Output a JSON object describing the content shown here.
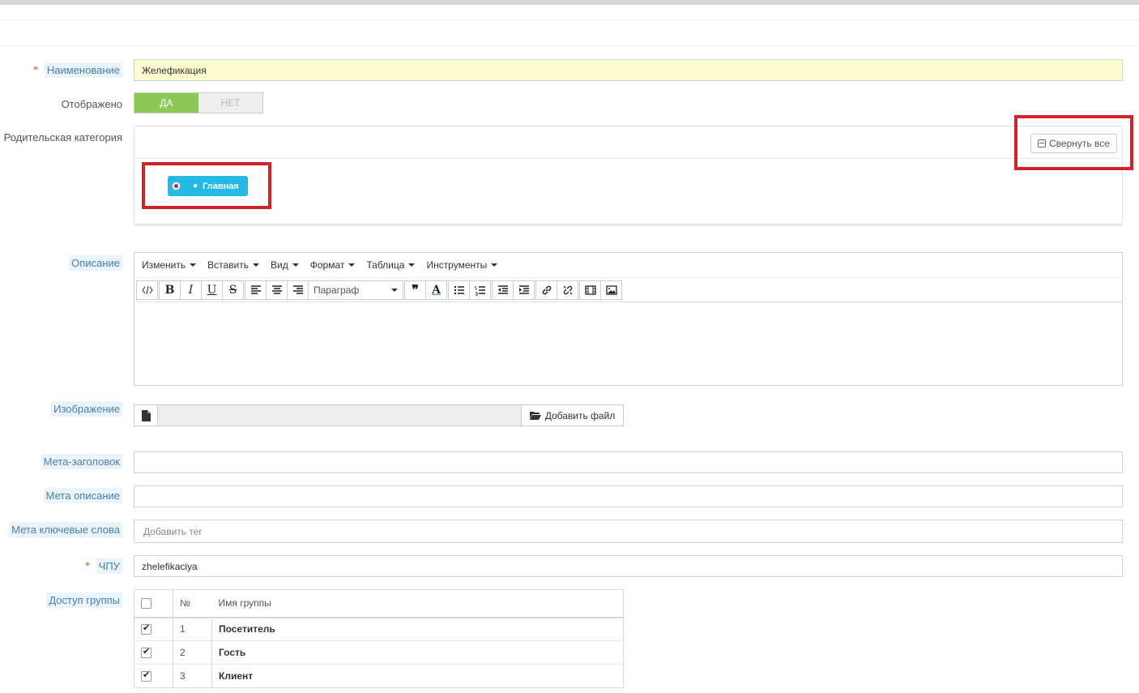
{
  "form": {
    "name": {
      "label": "Наименование",
      "value": "Желефикация",
      "required": true
    },
    "displayed": {
      "label": "Отображено",
      "yes": "ДА",
      "no": "НЕТ",
      "selected": "ДА"
    },
    "parent_category": {
      "label": "Родительская категория",
      "collapse_label": "Свернуть все",
      "root": "Главная"
    },
    "description": {
      "label": "Описание",
      "menu": [
        "Изменить",
        "Вставить",
        "Вид",
        "Формат",
        "Таблица",
        "Инструменты"
      ],
      "format_select": "Параграф"
    },
    "image": {
      "label": "Изображение",
      "add_file": "Добавить файл"
    },
    "meta_title": {
      "label": "Мета-заголовок",
      "value": ""
    },
    "meta_description": {
      "label": "Мета описание",
      "value": ""
    },
    "meta_keywords": {
      "label": "Мета ключевые слова",
      "placeholder": "Добавить тег"
    },
    "seo_url": {
      "label": "ЧПУ",
      "value": "zhelefikaciya",
      "required": true
    },
    "group_access": {
      "label": "Доступ группы",
      "headers": {
        "num": "№",
        "name": "Имя группы"
      },
      "rows": [
        {
          "num": "1",
          "name": "Посетитель",
          "checked": true
        },
        {
          "num": "2",
          "name": "Гость",
          "checked": true
        },
        {
          "num": "3",
          "name": "Клиент",
          "checked": true
        }
      ]
    }
  },
  "colors": {
    "accent": "#25b9e8",
    "toggle_on": "#8bc954",
    "highlight": "#d2232a",
    "required": "#e74c3c"
  }
}
